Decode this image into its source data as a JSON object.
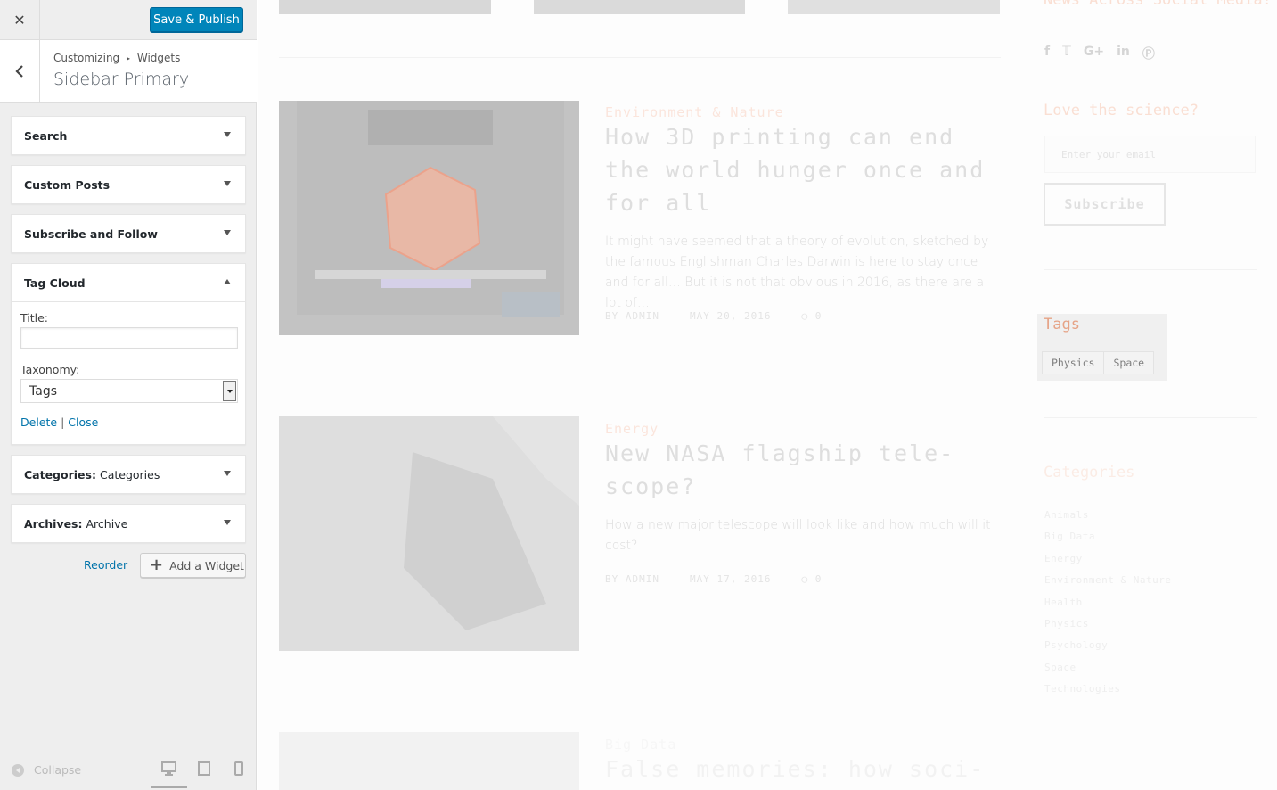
{
  "customizer": {
    "save_label": "Save & Publish",
    "close_icon": "✕",
    "breadcrumb": {
      "root": "Customizing",
      "separator": "▸",
      "current": "Widgets"
    },
    "section_title": "Sidebar Primary",
    "widgets": [
      {
        "title": "Search",
        "sub": "",
        "expanded": false
      },
      {
        "title": "Custom Posts",
        "sub": "",
        "expanded": false
      },
      {
        "title": "Subscribe and Follow",
        "sub": "",
        "expanded": false
      },
      {
        "title": "Tag Cloud",
        "sub": "",
        "expanded": true
      },
      {
        "title": "Categories:",
        "sub": "Categories",
        "expanded": false
      },
      {
        "title": "Archives:",
        "sub": "Archive",
        "expanded": false
      }
    ],
    "tag_cloud_form": {
      "title_label": "Title:",
      "title_value": "",
      "taxonomy_label": "Taxonomy:",
      "taxonomy_value": "Tags",
      "delete_label": "Delete",
      "separator": "|",
      "close_label": "Close"
    },
    "reorder_label": "Reorder",
    "add_widget_label": "Add a Widget",
    "collapse_label": "Collapse",
    "devices": [
      "desktop",
      "tablet",
      "mobile"
    ],
    "active_device": "desktop"
  },
  "preview": {
    "posts": [
      {
        "category": "Environment & Nature",
        "title": "How 3D printing can end the world hunger once and for all",
        "excerpt": "It might have seemed that a theory of evolution, sketched by the famous Englishman Charles Darwin is here to stay once and for all… But it is not that obvious in 2016, as there are a lot of…",
        "author": "BY ADMIN",
        "date": "MAY 20, 2016",
        "comments": "0"
      },
      {
        "category": "Energy",
        "title": "New NASA flagship tele-scope?",
        "excerpt": "How a new major telescope will look like and how much will it cost?",
        "author": "BY ADMIN",
        "date": "MAY 17, 2016",
        "comments": "0"
      },
      {
        "category": "Big Data",
        "title": "False memories: how soci-",
        "excerpt": "",
        "author": "",
        "date": "",
        "comments": ""
      }
    ],
    "sidebar": {
      "social_heading": "News Across Social Media!",
      "social_icons": [
        "facebook-icon",
        "twitter-icon",
        "google-plus-icon",
        "linkedin-icon",
        "pinterest-icon"
      ],
      "newsletter_heading": "Love the science?",
      "email_placeholder": "Enter your email",
      "subscribe_label": "Subscribe",
      "tags_heading": "Tags",
      "tags": [
        "Physics",
        "Space"
      ],
      "categories_heading": "Categories",
      "categories": [
        "Animals",
        "Big Data",
        "Energy",
        "Environment & Nature",
        "Health",
        "Physics",
        "Psychology",
        "Space",
        "Technologies"
      ]
    }
  }
}
